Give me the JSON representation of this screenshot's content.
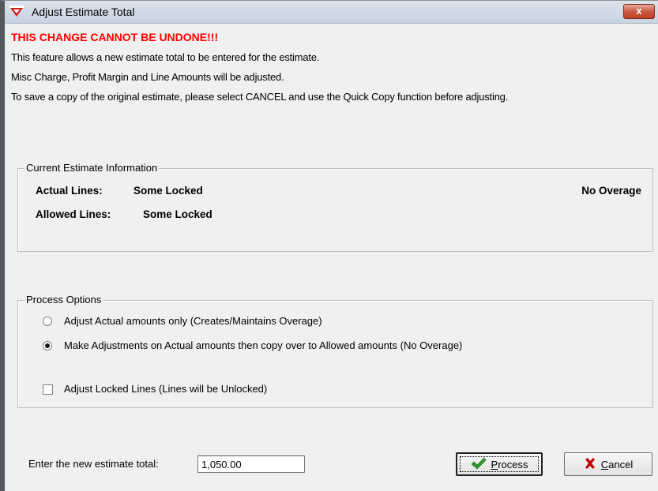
{
  "window": {
    "title": "Adjust Estimate Total",
    "close_label": "x"
  },
  "messages": {
    "warning": "THIS CHANGE CANNOT BE UNDONE!!!",
    "info1": "This feature allows a new estimate total to be entered for the estimate.",
    "info2": "Misc Charge, Profit Margin and Line Amounts will be adjusted.",
    "info3": "To save a copy of the original estimate, please select CANCEL and use the Quick Copy function before adjusting."
  },
  "current_info": {
    "legend": "Current Estimate Information",
    "actual_label": "Actual Lines:",
    "actual_value": "Some Locked",
    "allowed_label": "Allowed Lines:",
    "allowed_value": "Some Locked",
    "overage": "No Overage"
  },
  "process_options": {
    "legend": "Process Options",
    "option1": "Adjust Actual amounts only (Creates/Maintains Overage)",
    "option2": "Make Adjustments on Actual amounts then copy over to Allowed amounts (No Overage)",
    "selected_option": 2,
    "locked_label": "Adjust Locked Lines (Lines will be Unlocked)",
    "locked_checked": false
  },
  "footer": {
    "new_total_label": "Enter the new estimate total:",
    "new_total_value": "1,050.00",
    "process_first": "P",
    "process_rest": "rocess",
    "cancel_first": "C",
    "cancel_rest": "ancel"
  },
  "icons": {
    "app": "app-logo-icon",
    "process": "checkmark-icon",
    "cancel": "x-icon"
  },
  "colors": {
    "warning": "#ff0000",
    "checkmark": "#2e9a2e",
    "cancel_x": "#c00000"
  }
}
